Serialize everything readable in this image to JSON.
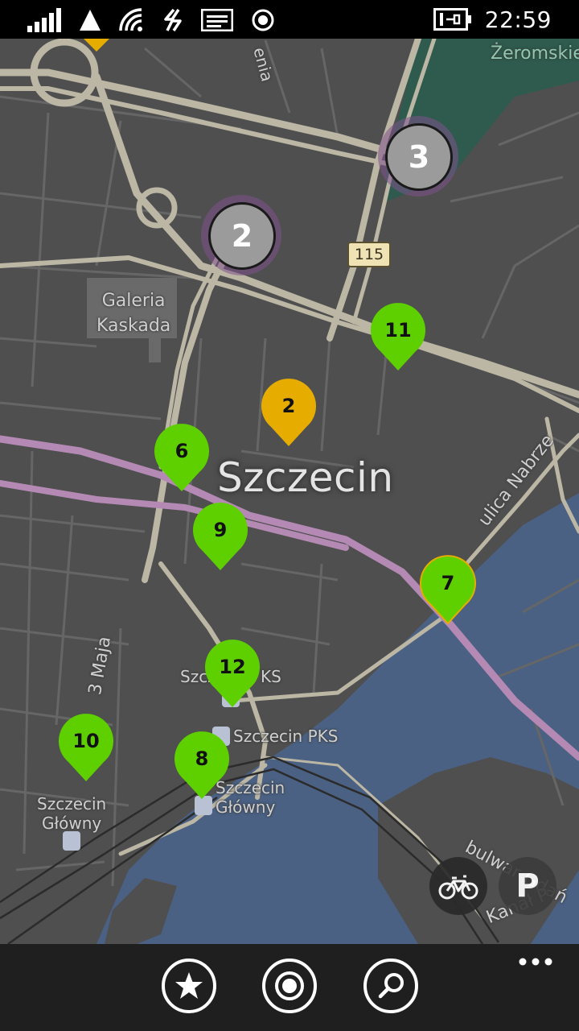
{
  "status_bar": {
    "time": "22:59",
    "icons": [
      "signal-icon",
      "no-sim-triangle-icon",
      "wifi-icon",
      "data-icon",
      "message-icon",
      "location-icon",
      "battery-charging-icon"
    ]
  },
  "map": {
    "city_label": "Szczecin",
    "labels": {
      "park": "Żeromskie",
      "mall_line1": "Galeria",
      "mall_line2": "Kaskada",
      "street_top": "enia",
      "street_3maja": "3 Maja",
      "street_nabrzeze": "ulica Nabrze",
      "street_bulwar": "bulwar Gdań",
      "street_kanal": "Kanał P",
      "pks_partial": "Szcz",
      "pks_partial_end": "KS",
      "pks": "Szczecin PKS",
      "glowny_right_line1": "Szczecin",
      "glowny_right_line2": "Główny",
      "glowny_left_line1": "Szczecin",
      "glowny_left_line2": "Główny"
    },
    "route_shield": "115",
    "clusters": [
      {
        "count": "3"
      },
      {
        "count": "2"
      }
    ],
    "pins": [
      {
        "count": "11",
        "color": "#5ed000"
      },
      {
        "count": "2",
        "color": "#e6ac00"
      },
      {
        "count": "6",
        "color": "#5ed000"
      },
      {
        "count": "9",
        "color": "#5ed000"
      },
      {
        "count": "7",
        "color": "#5ed000"
      },
      {
        "count": "12",
        "color": "#5ed000"
      },
      {
        "count": "10",
        "color": "#5ed000"
      },
      {
        "count": "8",
        "color": "#5ed000"
      }
    ],
    "buttons": {
      "bike": "bike-icon",
      "parking_label": "P"
    },
    "colors": {
      "background": "#4f4f4f",
      "water": "#4a6183",
      "park": "#2e5b4d",
      "road": "#bcb7a4",
      "rail_line": "#b48ab5",
      "pin_green": "#5ed000",
      "pin_orange": "#e6ac00",
      "cluster_ring": "#80528c"
    }
  },
  "app_bar": {
    "buttons": [
      "favorites-star-icon",
      "my-location-icon",
      "search-icon"
    ],
    "more": "more-dots-icon"
  }
}
